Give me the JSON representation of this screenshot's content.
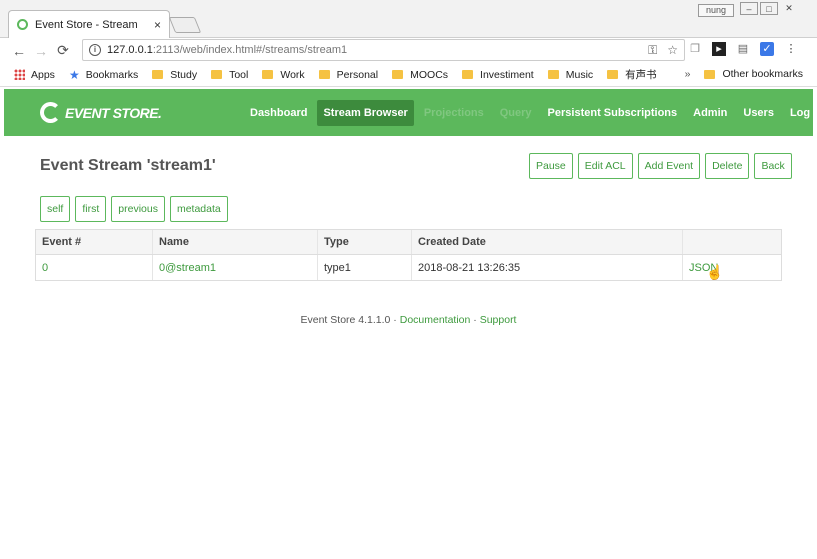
{
  "browser": {
    "tab_title": "Event Store - Stream",
    "tab_close": "×",
    "user_badge": "nung",
    "address_host": "127.0.0.1",
    "address_rest": ":2113/web/index.html#/streams/stream1",
    "bookmarks": [
      "Apps",
      "Bookmarks",
      "Study",
      "Tool",
      "Work",
      "Personal",
      "MOOCs",
      "Investiment",
      "Music",
      "有声书"
    ],
    "overflow": "»",
    "other_bookmarks": "Other bookmarks"
  },
  "navbar": {
    "logo": "EVENT STORE.",
    "items": [
      "Dashboard",
      "Stream Browser",
      "Projections",
      "Query",
      "Persistent Subscriptions",
      "Admin",
      "Users",
      "Log Out"
    ],
    "active": "Stream Browser",
    "brand_color": "#5cb85c"
  },
  "page": {
    "title": "Event Stream 'stream1'",
    "actions": [
      "Pause",
      "Edit ACL",
      "Add Event",
      "Delete",
      "Back"
    ],
    "links": [
      "self",
      "first",
      "previous",
      "metadata"
    ]
  },
  "table": {
    "headers": [
      "Event #",
      "Name",
      "Type",
      "Created Date",
      ""
    ],
    "rows": [
      {
        "event_no": "0",
        "name": "0@stream1",
        "type": "type1",
        "created": "2018-08-21 13:26:35",
        "link": "JSON"
      }
    ]
  },
  "footer": {
    "version": "Event Store 4.1.1.0 · ",
    "documentation": "Documentation",
    "sep": " · ",
    "support": "Support"
  }
}
